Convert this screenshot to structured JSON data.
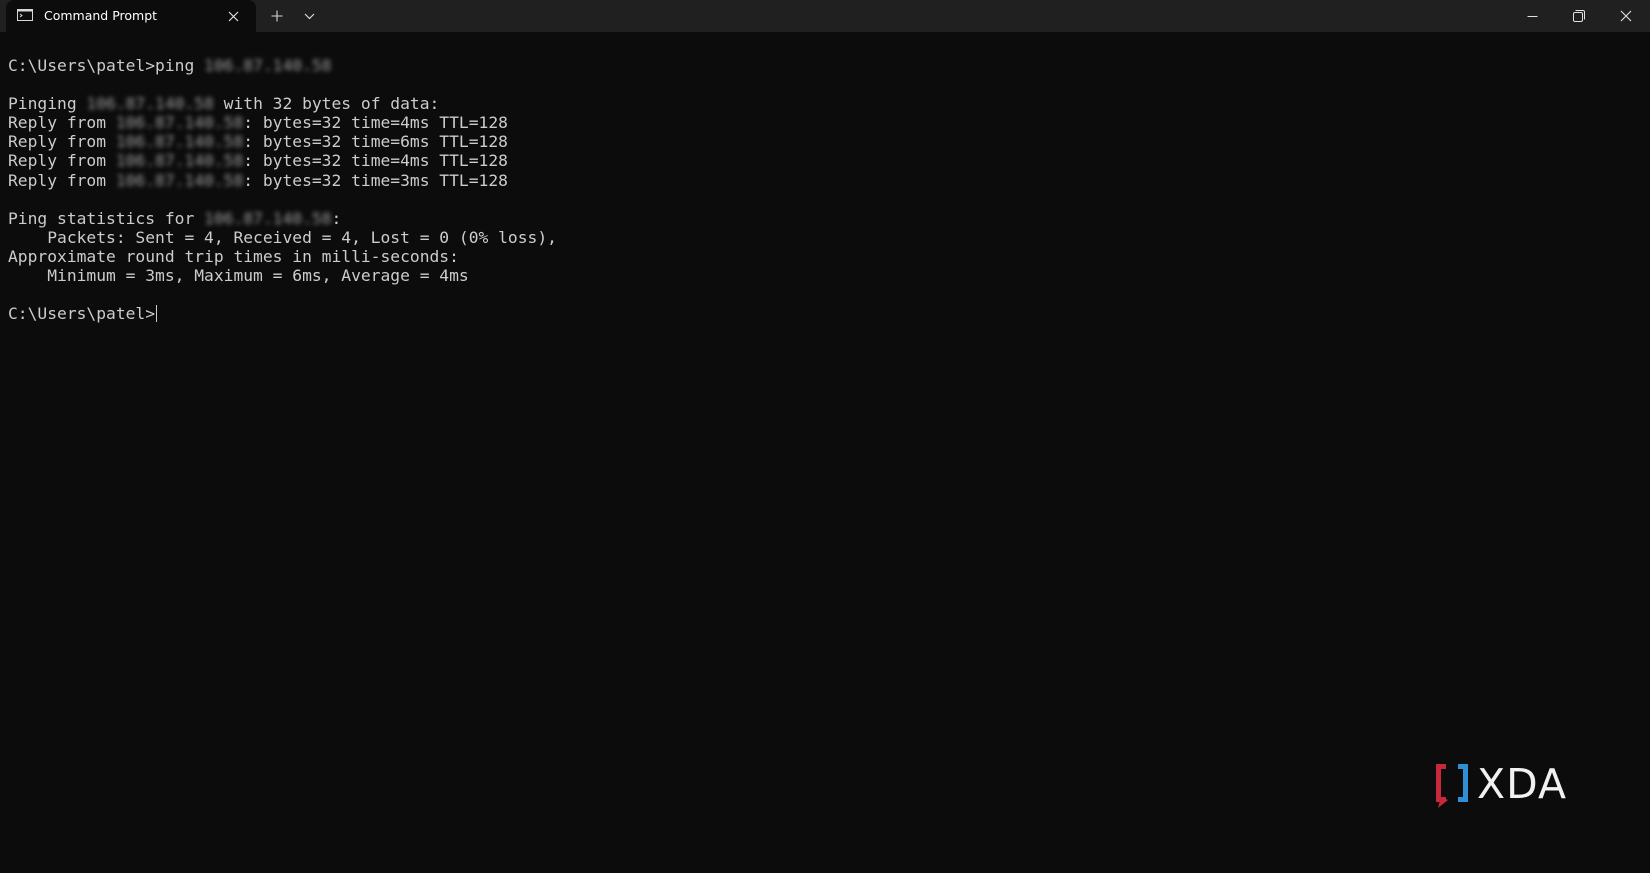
{
  "window": {
    "tab_title": "Command Prompt",
    "icons": {
      "tab": "terminal-icon",
      "close_tab": "close-icon",
      "new_tab": "plus-icon",
      "dropdown": "chevron-down-icon",
      "minimize": "minimize-icon",
      "maximize": "restore-icon",
      "close": "close-icon"
    }
  },
  "terminal": {
    "colors": {
      "background": "#0c0c0c",
      "text": "#cccccc",
      "titlebar": "#202020"
    },
    "lines": [
      {
        "pre": "C:\\Users\\patel>ping ",
        "blur": "106.87.140.58",
        "post": ""
      },
      {
        "pre": "",
        "blur": "",
        "post": ""
      },
      {
        "pre": "Pinging ",
        "blur": "106.87.140.58",
        "post": " with 32 bytes of data:"
      },
      {
        "pre": "Reply from ",
        "blur": "106.87.140.58",
        "post": ": bytes=32 time=4ms TTL=128"
      },
      {
        "pre": "Reply from ",
        "blur": "106.87.140.58",
        "post": ": bytes=32 time=6ms TTL=128"
      },
      {
        "pre": "Reply from ",
        "blur": "106.87.140.58",
        "post": ": bytes=32 time=4ms TTL=128"
      },
      {
        "pre": "Reply from ",
        "blur": "106.87.140.58",
        "post": ": bytes=32 time=3ms TTL=128"
      },
      {
        "pre": "",
        "blur": "",
        "post": ""
      },
      {
        "pre": "Ping statistics for ",
        "blur": "106.87.140.58",
        "post": ":"
      },
      {
        "pre": "    Packets: Sent = 4, Received = 4, Lost = 0 (0% loss),",
        "blur": "",
        "post": ""
      },
      {
        "pre": "Approximate round trip times in milli-seconds:",
        "blur": "",
        "post": ""
      },
      {
        "pre": "    Minimum = 3ms, Maximum = 6ms, Average = 4ms",
        "blur": "",
        "post": ""
      },
      {
        "pre": "",
        "blur": "",
        "post": ""
      },
      {
        "pre": "C:\\Users\\patel>",
        "blur": "",
        "post": "",
        "cursor": true
      }
    ]
  },
  "watermark": {
    "text": "XDA",
    "colors": {
      "bracket_left": "#c8283c",
      "bracket_right": "#2f8fd6",
      "text": "#f1f1f1"
    }
  }
}
